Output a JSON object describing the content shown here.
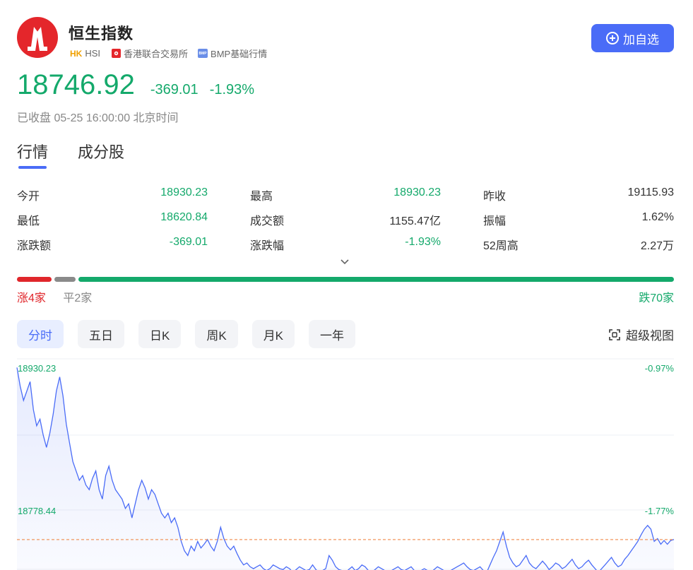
{
  "header": {
    "name": "恒生指数",
    "market_tag": "HK",
    "code": "HSI",
    "exchange": "香港联合交易所",
    "data_source_icon": "BMP",
    "data_source": "BMP基础行情",
    "add_button": "加自选",
    "logo_icon": "hang-seng-logo"
  },
  "quote": {
    "price": "18746.92",
    "change": "-369.01",
    "change_pct": "-1.93%",
    "status": "已收盘 05-25 16:00:00 北京时间"
  },
  "tabs": [
    {
      "label": "行情",
      "active": true
    },
    {
      "label": "成分股",
      "active": false
    }
  ],
  "stats": [
    [
      {
        "label": "今开",
        "value": "18930.23",
        "color": "green"
      },
      {
        "label": "最高",
        "value": "18930.23",
        "color": "green"
      },
      {
        "label": "昨收",
        "value": "19115.93",
        "color": "normal"
      }
    ],
    [
      {
        "label": "最低",
        "value": "18620.84",
        "color": "green"
      },
      {
        "label": "成交额",
        "value": "1155.47亿",
        "color": "normal"
      },
      {
        "label": "振幅",
        "value": "1.62%",
        "color": "normal"
      }
    ],
    [
      {
        "label": "涨跌额",
        "value": "-369.01",
        "color": "green"
      },
      {
        "label": "涨跌幅",
        "value": "-1.93%",
        "color": "green"
      },
      {
        "label": "52周高",
        "value": "2.27万",
        "color": "normal"
      }
    ]
  ],
  "breadth": {
    "up": 4,
    "flat": 2,
    "down": 70,
    "up_label": "涨4家",
    "flat_label": "平2家",
    "down_label": "跌70家",
    "colors": {
      "up": "#e0262b",
      "flat": "#8a8a8a",
      "down": "#14a96b"
    }
  },
  "periods": [
    {
      "label": "分时",
      "active": true
    },
    {
      "label": "五日",
      "active": false
    },
    {
      "label": "日K",
      "active": false
    },
    {
      "label": "周K",
      "active": false
    },
    {
      "label": "月K",
      "active": false
    },
    {
      "label": "一年",
      "active": false
    }
  ],
  "super_view": "超级视图",
  "colors": {
    "accent": "#4a6cf7",
    "fall": "#14a96b",
    "rise": "#e0262b",
    "line": "#4a6cf7"
  },
  "chart_data": {
    "type": "line",
    "y_left_labels": [
      "18930.23",
      "18778.44"
    ],
    "y_right_labels": [
      "-0.97%",
      "-1.77%"
    ],
    "reference_value": 18746.92,
    "ylim": [
      18700,
      18930.23
    ],
    "grid": true,
    "x": [
      0,
      1,
      2,
      3,
      4,
      5,
      6,
      7,
      8,
      9,
      10,
      11,
      12,
      13,
      14,
      15,
      16,
      17,
      18,
      19,
      20,
      21,
      22,
      23,
      24,
      25,
      26,
      27,
      28,
      29,
      30,
      31,
      32,
      33,
      34,
      35,
      36,
      37,
      38,
      39,
      40,
      41,
      42,
      43,
      44,
      45,
      46,
      47,
      48,
      49,
      50,
      51,
      52,
      53,
      54,
      55,
      56,
      57,
      58,
      59,
      60,
      61,
      62,
      63,
      64,
      65,
      66,
      67,
      68,
      69,
      70,
      71,
      72,
      73,
      74,
      75,
      76,
      77,
      78,
      79,
      80,
      81,
      82,
      83,
      84,
      85,
      86,
      87,
      88,
      89,
      90,
      91,
      92,
      93,
      94,
      95,
      96,
      97,
      98,
      99,
      100,
      101,
      102,
      103,
      104,
      105,
      106,
      107,
      108,
      109,
      110,
      111,
      112,
      113,
      114,
      115,
      116,
      117,
      118,
      119,
      120,
      121,
      122,
      123,
      124,
      125,
      126,
      127,
      128,
      129,
      130,
      131,
      132,
      133,
      134,
      135,
      136,
      137,
      138,
      139,
      140,
      141,
      142,
      143,
      144,
      145,
      146,
      147,
      148,
      149,
      150,
      151,
      152,
      153,
      154,
      155,
      156,
      157,
      158,
      159,
      160,
      161,
      162,
      163,
      164,
      165,
      166,
      167,
      168,
      169,
      170,
      171,
      172,
      173,
      174,
      175,
      176,
      177,
      178,
      179,
      180,
      181,
      182,
      183,
      184,
      185,
      186,
      187,
      188,
      189,
      190,
      191,
      192,
      193,
      194,
      195,
      196,
      197,
      198,
      199,
      200
    ],
    "values": [
      18930,
      18910,
      18895,
      18905,
      18915,
      18885,
      18868,
      18875,
      18858,
      18845,
      18860,
      18880,
      18905,
      18920,
      18900,
      18870,
      18850,
      18830,
      18820,
      18810,
      18815,
      18805,
      18800,
      18812,
      18820,
      18800,
      18790,
      18815,
      18825,
      18810,
      18800,
      18795,
      18790,
      18780,
      18785,
      18770,
      18785,
      18800,
      18810,
      18802,
      18790,
      18800,
      18795,
      18785,
      18775,
      18770,
      18775,
      18765,
      18770,
      18760,
      18745,
      18735,
      18730,
      18740,
      18735,
      18745,
      18738,
      18742,
      18747,
      18740,
      18735,
      18745,
      18760,
      18748,
      18740,
      18736,
      18740,
      18732,
      18725,
      18720,
      18722,
      18718,
      18716,
      18718,
      18720,
      18716,
      18714,
      18716,
      18720,
      18718,
      18716,
      18715,
      18718,
      18716,
      18712,
      18715,
      18718,
      18716,
      18714,
      18715,
      18720,
      18715,
      18712,
      18714,
      18716,
      18730,
      18725,
      18718,
      18715,
      18714,
      18712,
      18715,
      18718,
      18714,
      18716,
      18720,
      18718,
      18714,
      18712,
      18715,
      18718,
      18716,
      18714,
      18712,
      18714,
      18716,
      18718,
      18715,
      18714,
      18716,
      18718,
      18714,
      18712,
      18714,
      18716,
      18714,
      18712,
      18715,
      18718,
      18716,
      18714,
      18712,
      18714,
      18716,
      18718,
      18720,
      18722,
      18718,
      18715,
      18714,
      18716,
      18718,
      18714,
      18712,
      18720,
      18728,
      18735,
      18745,
      18755,
      18740,
      18728,
      18722,
      18718,
      18720,
      18725,
      18730,
      18722,
      18718,
      18716,
      18720,
      18724,
      18720,
      18715,
      18718,
      18722,
      18720,
      18716,
      18718,
      18722,
      18726,
      18720,
      18716,
      18718,
      18722,
      18725,
      18720,
      18716,
      18712,
      18716,
      18720,
      18724,
      18728,
      18722,
      18718,
      18720,
      18726,
      18730,
      18735,
      18740,
      18745,
      18752,
      18758,
      18762,
      18758,
      18745,
      18748,
      18742,
      18746,
      18742,
      18746,
      18747
    ]
  }
}
